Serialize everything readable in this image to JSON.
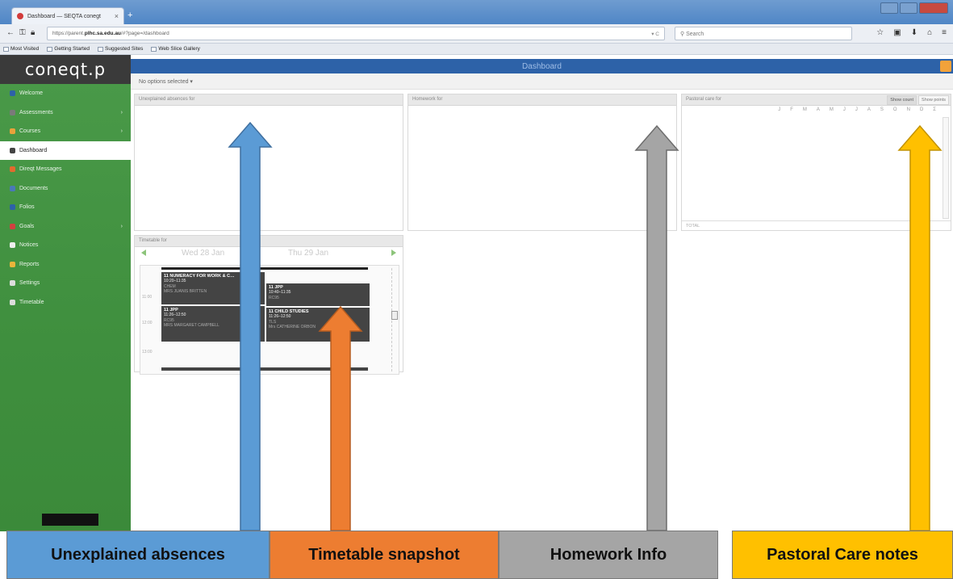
{
  "browser": {
    "tab_title": "Dashboard — SEQTA conegt",
    "tab_close": "×",
    "new_tab": "+",
    "url_prefix": "https://parent.",
    "url_domain": "plhc.sa.edu.au",
    "url_path": "/#?page=/dashboard",
    "reload": "▾ C",
    "search_placeholder": "Search",
    "bookmarks": [
      "Most Visited",
      "Getting Started",
      "Suggested Sites",
      "Web Slice Gallery"
    ]
  },
  "app": {
    "logo": "coneqt.p",
    "header_title": "Dashboard",
    "options_label": "No options selected ▾",
    "sidebar": [
      {
        "label": "Welcome",
        "icon": "info-icon",
        "color": "#2d62a8",
        "chev": false,
        "active": false
      },
      {
        "label": "Assessments",
        "icon": "assessment-icon",
        "color": "#7a7a7a",
        "chev": true,
        "active": false
      },
      {
        "label": "Courses",
        "icon": "courses-icon",
        "color": "#e9a23b",
        "chev": true,
        "active": false
      },
      {
        "label": "Dashboard",
        "icon": "dashboard-icon",
        "color": "#444444",
        "chev": false,
        "active": true
      },
      {
        "label": "Direqt Messages",
        "icon": "messages-icon",
        "color": "#e26b2e",
        "chev": false,
        "active": false
      },
      {
        "label": "Documents",
        "icon": "documents-icon",
        "color": "#4a79b8",
        "chev": false,
        "active": false
      },
      {
        "label": "Folios",
        "icon": "folios-icon",
        "color": "#2d62a8",
        "chev": false,
        "active": false
      },
      {
        "label": "Goals",
        "icon": "goals-icon",
        "color": "#d24040",
        "chev": true,
        "active": false
      },
      {
        "label": "Notices",
        "icon": "notices-icon",
        "color": "#eeeeee",
        "chev": false,
        "active": false
      },
      {
        "label": "Reports",
        "icon": "reports-icon",
        "color": "#e9b53b",
        "chev": false,
        "active": false
      },
      {
        "label": "Settings",
        "icon": "settings-icon",
        "color": "#dddddd",
        "chev": false,
        "active": false
      },
      {
        "label": "Timetable",
        "icon": "timetable-icon",
        "color": "#dddddd",
        "chev": false,
        "active": false
      }
    ],
    "panels": {
      "absences_title": "Unexplained absences for",
      "homework_title": "Homework for",
      "pastoral_title": "Pastoral care for",
      "show_count": "Show count",
      "show_points": "Show points",
      "months": [
        "J",
        "F",
        "M",
        "A",
        "M",
        "J",
        "J",
        "A",
        "S",
        "O",
        "N",
        "D",
        "Σ"
      ],
      "total_label": "TOTAL",
      "total_value": "0",
      "timetable_title": "Timetable for"
    },
    "timetable": {
      "day1": "Wed 28 Jan",
      "day2": "Thu 29 Jan",
      "times": [
        "11:00",
        "12:00",
        "13:00"
      ],
      "lessons": [
        {
          "title": "11 NUMERACY FOR WORK & C…",
          "time": "10:20–11:35",
          "room": "CHEM",
          "teacher": "MRS JUANIS BRITTEN"
        },
        {
          "title": "11 JPP",
          "time": "11:26–12:50",
          "room": "RC95",
          "teacher": "MRS MARGARET CAMPBELL"
        },
        {
          "title": "11 JPP",
          "time": "10:40–11:35",
          "room": "RC95",
          "teacher": ""
        },
        {
          "title": "11 CHILD STUDIES",
          "time": "11:26–12:50",
          "room": "TLS",
          "teacher": "Mrs CATHERINE ORBON"
        }
      ]
    }
  },
  "annotations": {
    "absences": "Unexplained absences",
    "timetable": "Timetable snapshot",
    "homework": "Homework Info",
    "pastoral": "Pastoral Care notes",
    "colors": {
      "absences": "#5b9bd5",
      "timetable": "#ed7d31",
      "homework": "#a5a5a5",
      "pastoral": "#ffc000"
    }
  }
}
